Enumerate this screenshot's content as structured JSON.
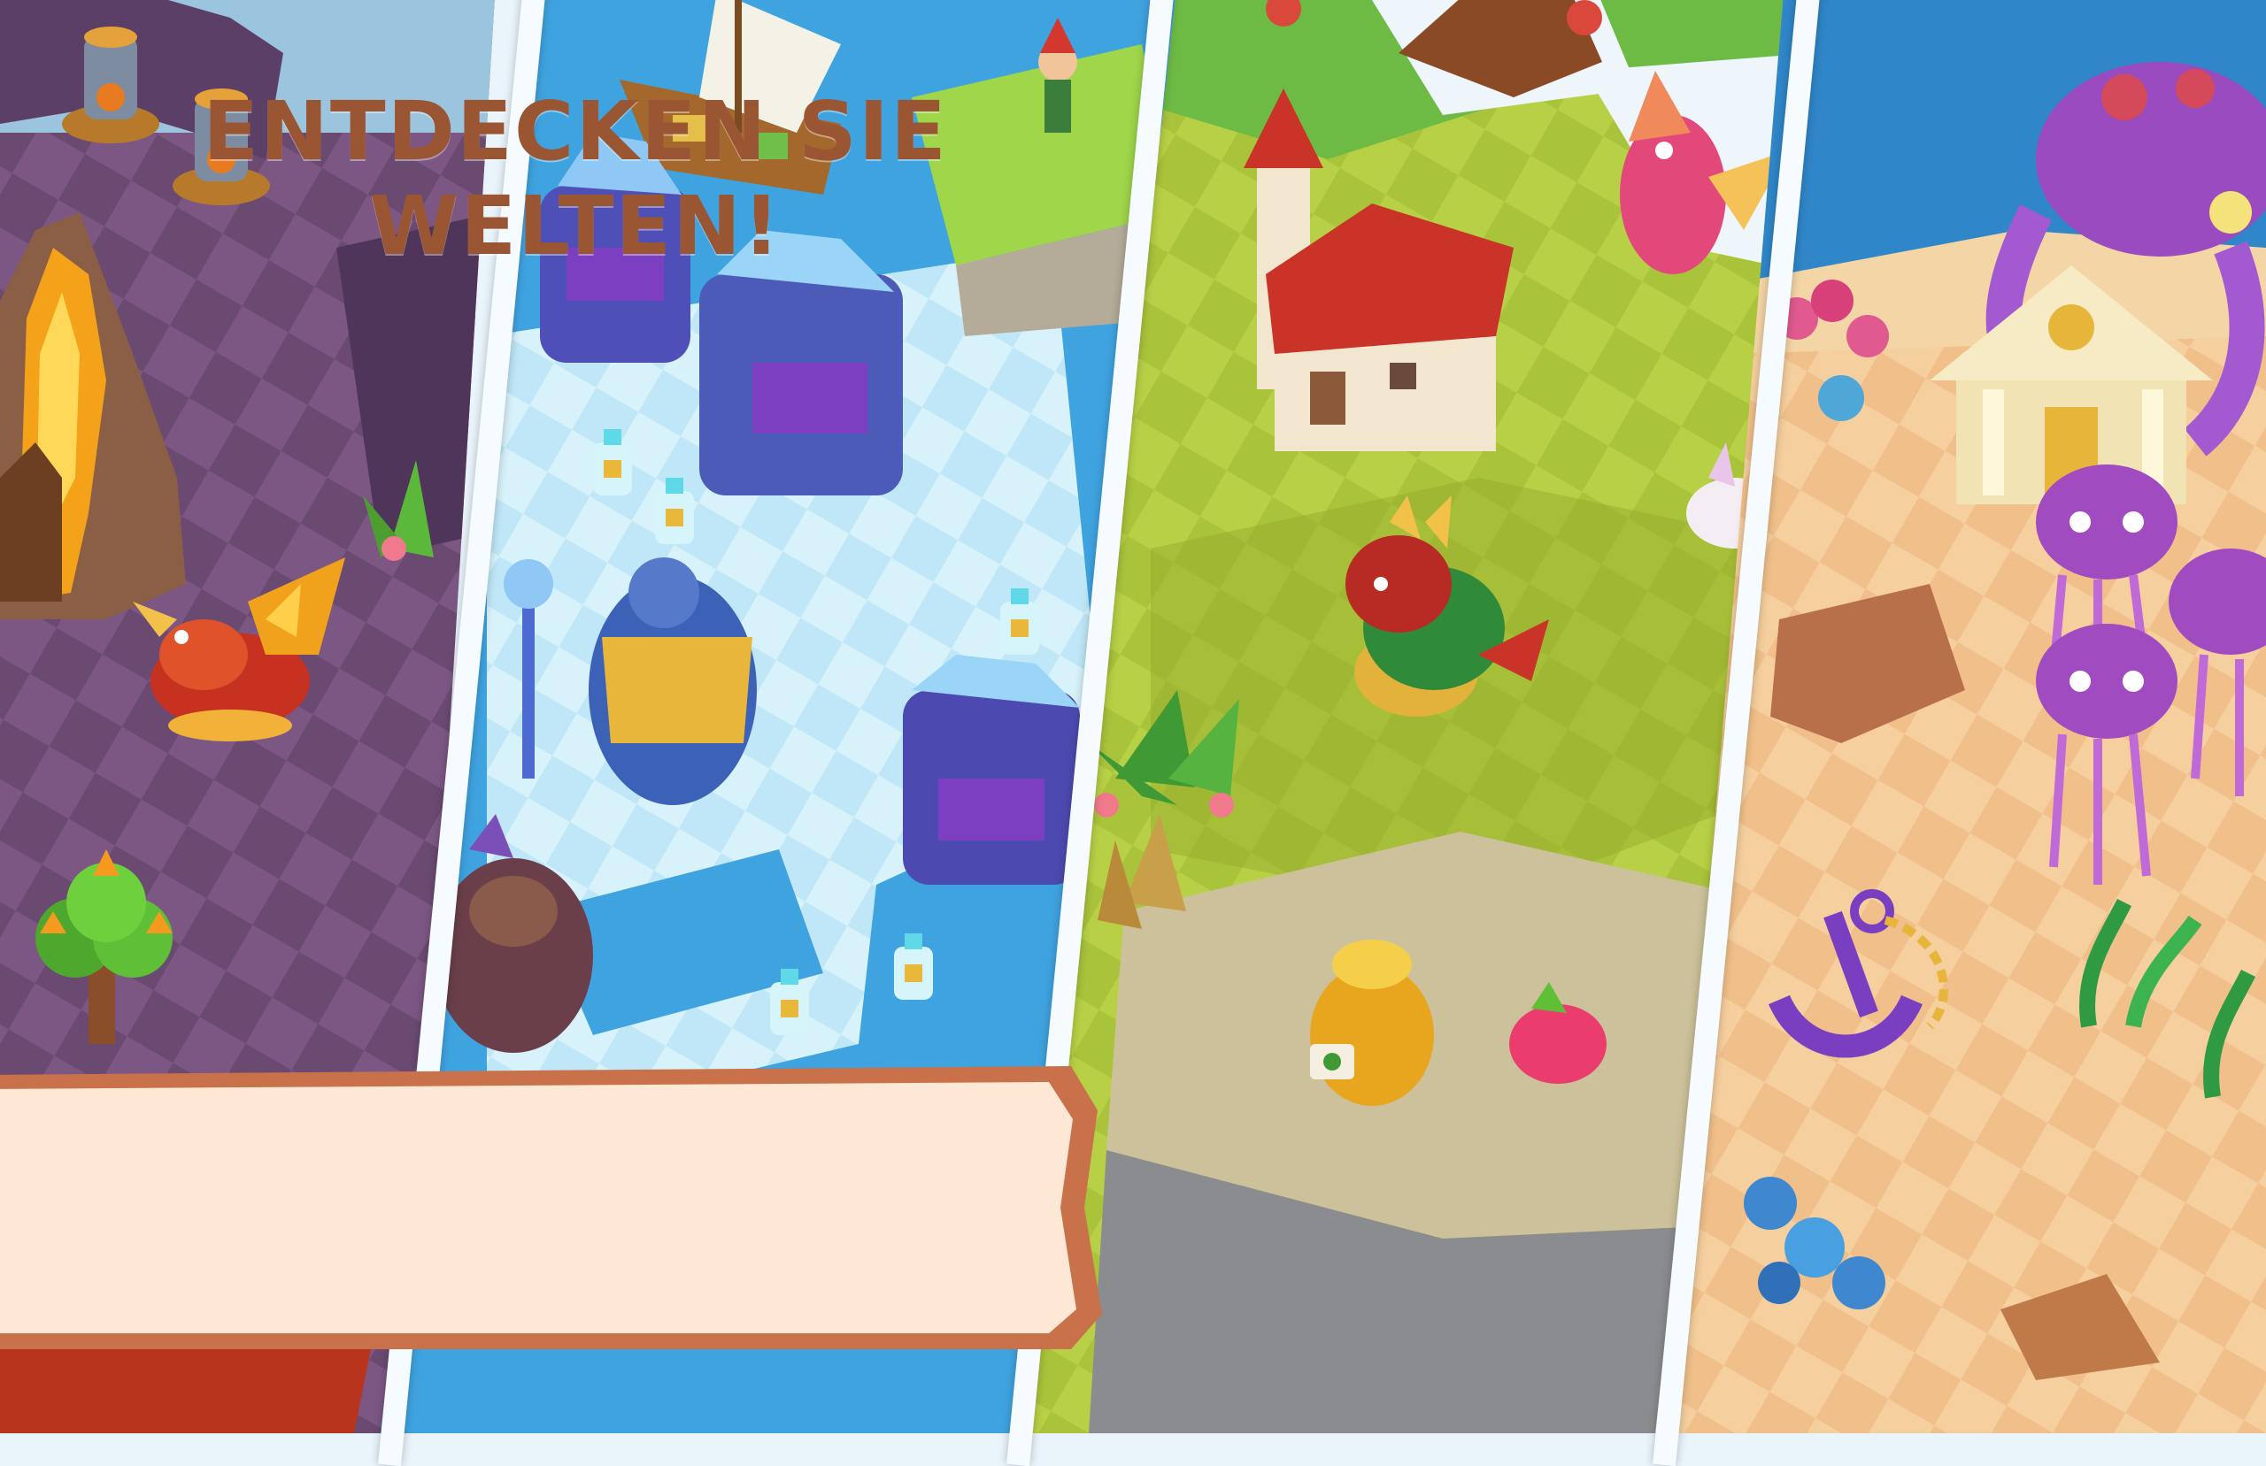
{
  "banner": {
    "text": "ENTDECKEN SIE WELTEN!"
  },
  "worlds": [
    {
      "icon": "lava-world-icon",
      "accent": "#6e4a73"
    },
    {
      "icon": "ice-world-icon",
      "accent": "#59aee4"
    },
    {
      "icon": "meadow-world-icon",
      "accent": "#a9c43b"
    },
    {
      "icon": "ocean-world-icon",
      "accent": "#f1c08a"
    }
  ],
  "colors": {
    "banner_fill": "#fde8d5",
    "banner_border": "#c9714a",
    "banner_text": "#9a5532"
  }
}
